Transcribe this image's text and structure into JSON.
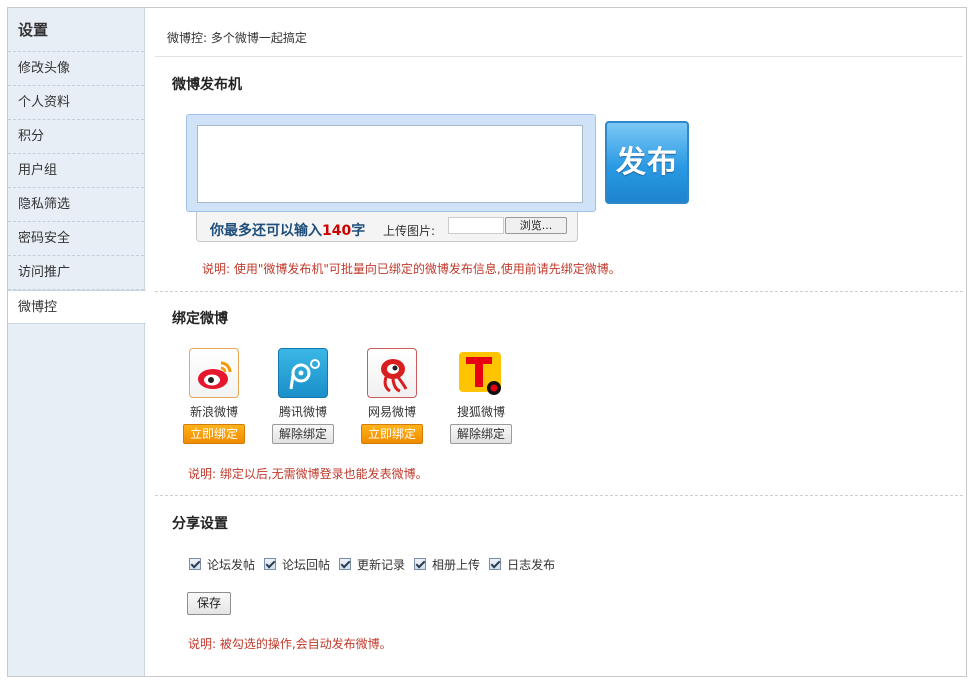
{
  "sidebar": {
    "title": "设置",
    "items": [
      {
        "label": "修改头像"
      },
      {
        "label": "个人资料"
      },
      {
        "label": "积分"
      },
      {
        "label": "用户组"
      },
      {
        "label": "隐私筛选"
      },
      {
        "label": "密码安全"
      },
      {
        "label": "访问推广"
      },
      {
        "label": "微博控"
      }
    ],
    "active_index": 7
  },
  "breadcrumb": "微博控: 多个微博一起搞定",
  "publisher": {
    "title": "微博发布机",
    "textarea_value": "",
    "remain_prefix": "你最多还可以输入",
    "remain_count": "140",
    "remain_suffix": "字",
    "upload_label": "上传图片:",
    "browse_label": "浏览...",
    "publish_label": "发布",
    "note": "说明:  使用\"微博发布机\"可批量向已绑定的微博发布信息,使用前请先绑定微博。"
  },
  "bind": {
    "title": "绑定微博",
    "services": [
      {
        "name": "新浪微博",
        "action": "立即绑定",
        "state": "bind",
        "icon": "sina-weibo-icon"
      },
      {
        "name": "腾讯微博",
        "action": "解除绑定",
        "state": "unbind",
        "icon": "tencent-weibo-icon"
      },
      {
        "name": "网易微博",
        "action": "立即绑定",
        "state": "bind",
        "icon": "netease-weibo-icon"
      },
      {
        "name": "搜狐微博",
        "action": "解除绑定",
        "state": "unbind",
        "icon": "sohu-weibo-icon"
      }
    ],
    "note": "说明:  绑定以后,无需微博登录也能发表微博。"
  },
  "share": {
    "title": "分享设置",
    "options": [
      {
        "label": "论坛发帖",
        "checked": true
      },
      {
        "label": "论坛回帖",
        "checked": true
      },
      {
        "label": "更新记录",
        "checked": true
      },
      {
        "label": "相册上传",
        "checked": true
      },
      {
        "label": "日志发布",
        "checked": true
      }
    ],
    "save_label": "保存",
    "note": "说明:  被勾选的操作,会自动发布微博。"
  },
  "colors": {
    "sidebar_bg": "#e7eef6",
    "note_red": "#c0392b",
    "count_red": "#cc0000",
    "bind_orange": "#f08a00",
    "publish_blue": "#2a9ae4"
  }
}
